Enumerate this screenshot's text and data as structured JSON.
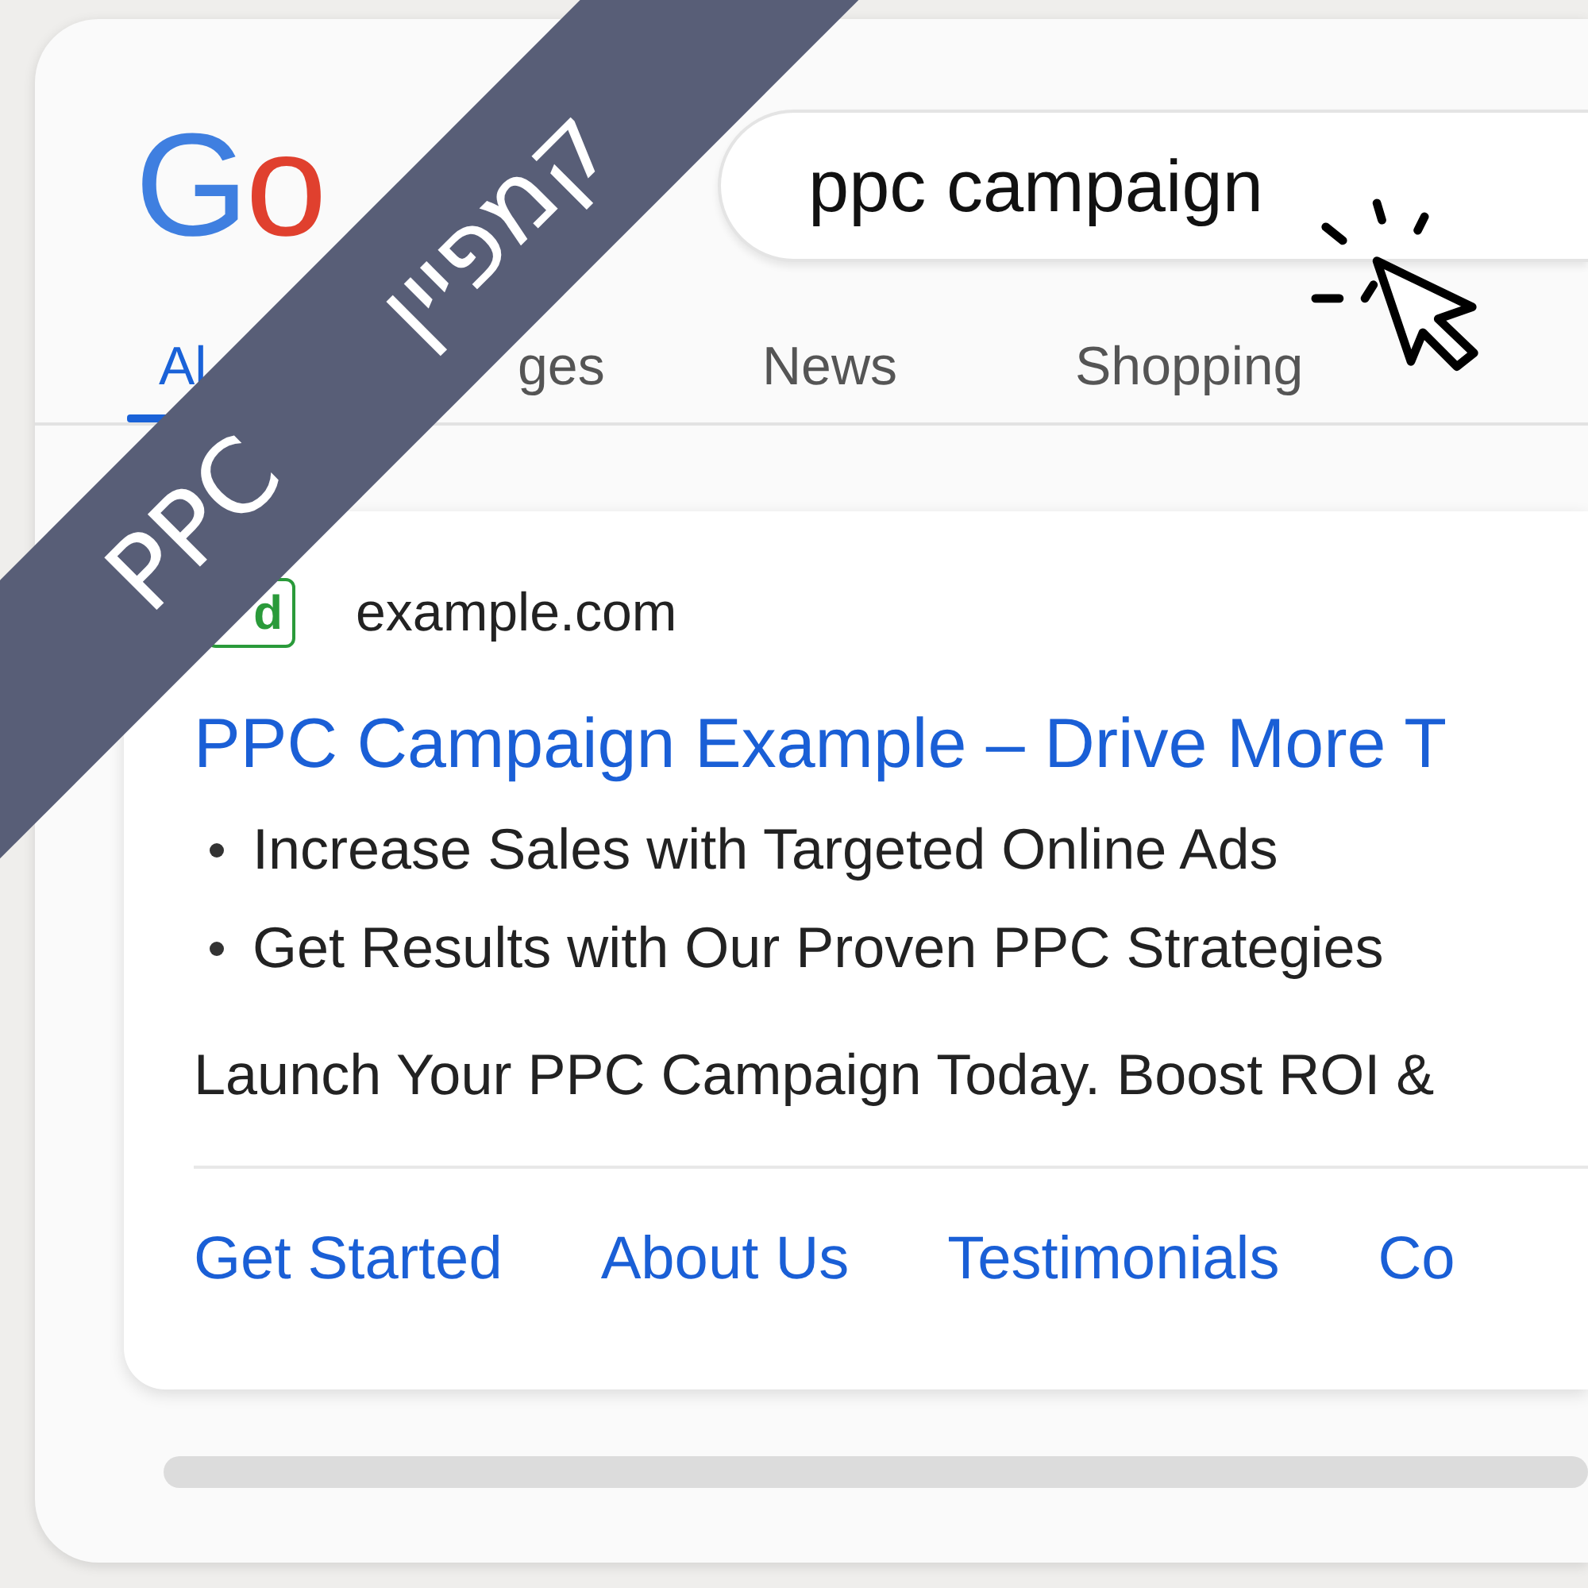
{
  "logo": {
    "text": "Go"
  },
  "search": {
    "value": "ppc campaign"
  },
  "tabs": [
    {
      "label": "Al",
      "selected": true
    },
    {
      "label": "ges",
      "selected": false
    },
    {
      "label": "News",
      "selected": false
    },
    {
      "label": "Shopping",
      "selected": false
    }
  ],
  "ad": {
    "badge": "d",
    "site": "example.com",
    "title": "PPC Campaign Example – Drive More T",
    "bullets": [
      "Increase Sales with Targeted Online Ads",
      "Get Results with Our Proven PPC Strategies"
    ],
    "description": "Launch Your PPC Campaign Today. Boost ROI &",
    "sitelinks": [
      "Get Started",
      "About Us",
      "Testimonials",
      "Co"
    ]
  },
  "ribbon": {
    "words": [
      "PPC",
      "קמפיין"
    ]
  }
}
